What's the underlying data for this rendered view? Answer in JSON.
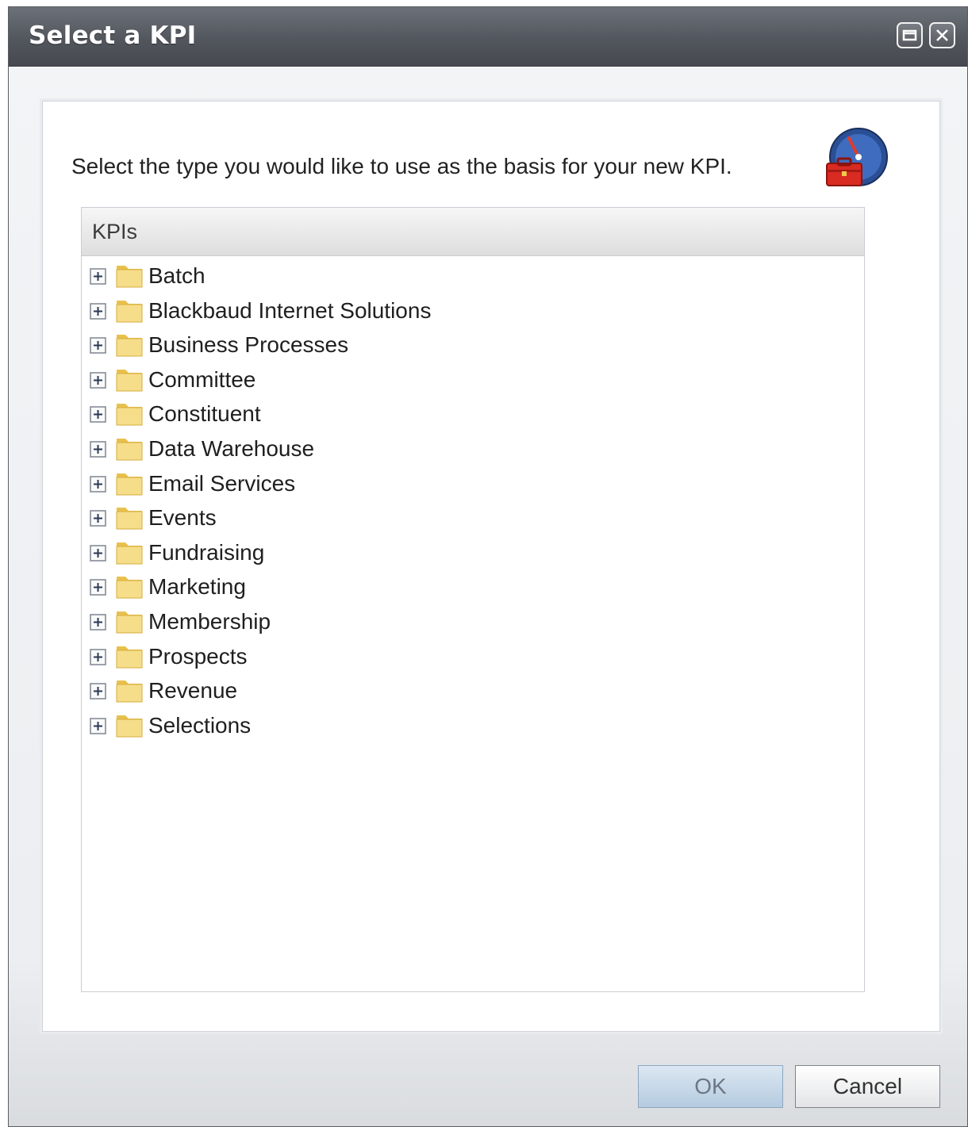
{
  "dialog": {
    "title": "Select a KPI",
    "maximize_icon": "window-maximize-icon",
    "close_icon": "close-icon"
  },
  "content": {
    "instruction": "Select the type you would like to use as the basis for your new KPI.",
    "kpi_icon": "gauge-toolbox-icon"
  },
  "tree": {
    "header": "KPIs",
    "items": [
      {
        "label": "Batch"
      },
      {
        "label": "Blackbaud Internet Solutions"
      },
      {
        "label": "Business Processes"
      },
      {
        "label": "Committee"
      },
      {
        "label": "Constituent"
      },
      {
        "label": "Data Warehouse"
      },
      {
        "label": "Email Services"
      },
      {
        "label": "Events"
      },
      {
        "label": "Fundraising"
      },
      {
        "label": "Marketing"
      },
      {
        "label": "Membership"
      },
      {
        "label": "Prospects"
      },
      {
        "label": "Revenue"
      },
      {
        "label": "Selections"
      }
    ]
  },
  "buttons": {
    "ok": "OK",
    "cancel": "Cancel"
  },
  "colors": {
    "titlebar": "#52565d",
    "ok_button": "#b5cbe0",
    "folder": "#f3d56b"
  }
}
